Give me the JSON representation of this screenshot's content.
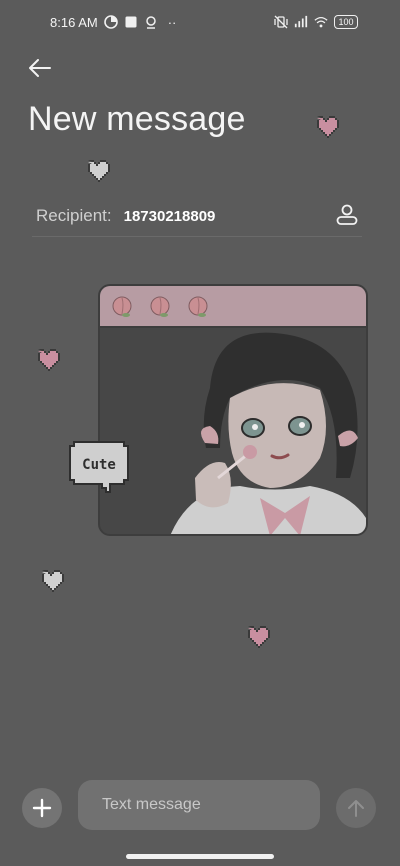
{
  "status_bar": {
    "time": "8:16 AM",
    "battery": "100",
    "dots": "··",
    "left_icons": [
      "pie-icon",
      "square-app-icon",
      "location-ring-icon"
    ],
    "right_icons": [
      "mute-vibrate-icon",
      "signal-icon",
      "wifi-icon",
      "battery-icon"
    ]
  },
  "header": {
    "title": "New message",
    "back_icon": "arrow-left-icon"
  },
  "recipient": {
    "label": "Recipient:",
    "value": "18730218809",
    "contact_icon": "person-icon"
  },
  "decor": {
    "bubble_text": "Cute",
    "colors": {
      "heart_pink": "#c98fa0",
      "heart_gray": "#cfcfcf",
      "card_top": "#b79ca3"
    }
  },
  "composer": {
    "placeholder": "Text message",
    "add_icon": "plus-icon",
    "send_icon": "arrow-up-icon"
  },
  "colors": {
    "background": "#5b5b5b",
    "input": "#717171"
  }
}
